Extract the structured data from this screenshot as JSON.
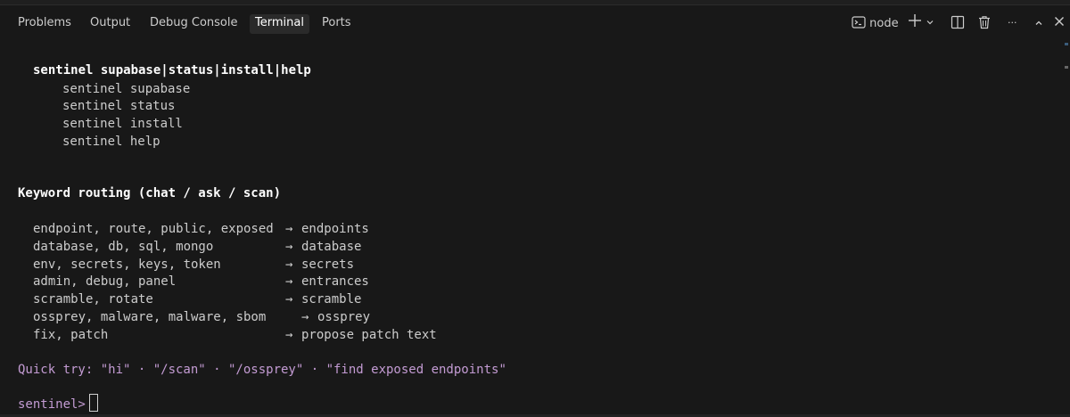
{
  "tabs": {
    "problems": "Problems",
    "output": "Output",
    "debug_console": "Debug Console",
    "terminal": "Terminal",
    "ports": "Ports"
  },
  "header": {
    "terminal_name": "node",
    "more": "···",
    "icons": [
      "terminal-icon",
      "plus-icon",
      "chevron-down-icon",
      "split-icon",
      "trash-icon",
      "more-icon",
      "caret-up-icon",
      "close-icon"
    ]
  },
  "terminal": {
    "usage_line": "sentinel supabase|status|install|help",
    "usage_items": [
      "sentinel supabase",
      "sentinel status",
      "sentinel install",
      "sentinel help"
    ],
    "routing_heading": "Keyword routing (chat / ask / scan)",
    "routes": [
      {
        "keywords": "endpoint, route, public, exposed",
        "target": "endpoints"
      },
      {
        "keywords": "database, db, sql, mongo",
        "target": "database"
      },
      {
        "keywords": "env, secrets, keys, token",
        "target": "secrets"
      },
      {
        "keywords": "admin, debug, panel",
        "target": "entrances"
      },
      {
        "keywords": "scramble, rotate",
        "target": "scramble"
      },
      {
        "keywords": "ossprey, malware, malware, sbom",
        "target": "ossprey"
      },
      {
        "keywords": "fix, patch",
        "target": "propose patch text"
      }
    ],
    "arrow": "→",
    "quick_try": "Quick try: \"hi\" · \"/scan\" · \"/ossprey\" · \"find exposed endpoints\"",
    "prompt": "sentinel>"
  }
}
